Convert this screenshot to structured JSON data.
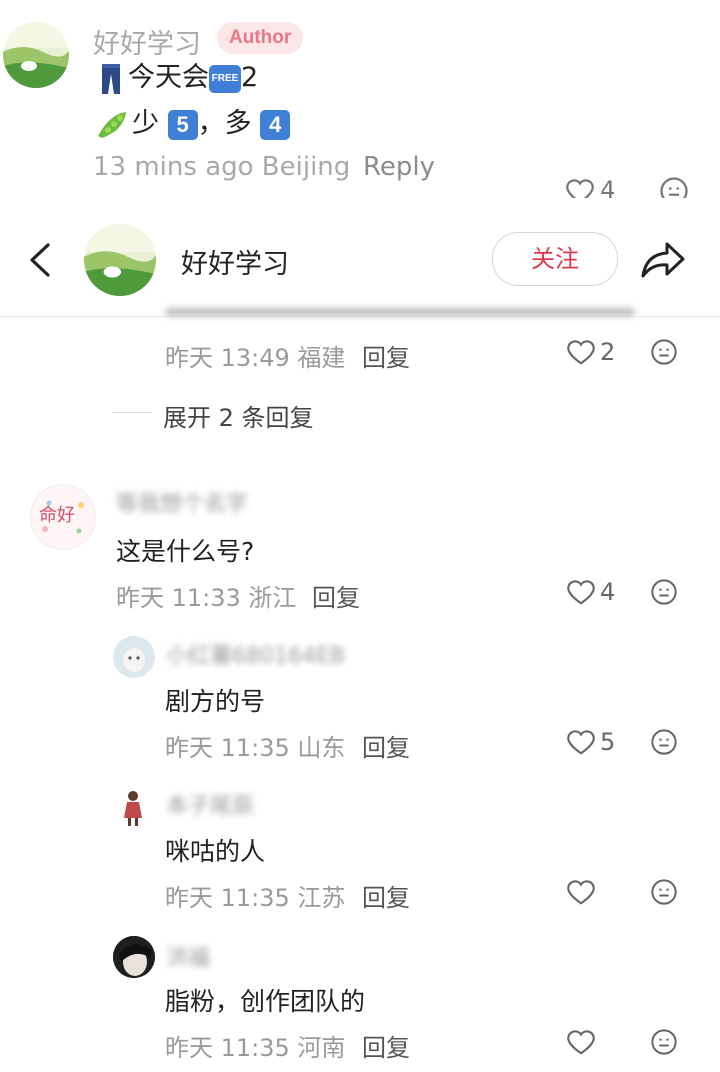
{
  "top_comment": {
    "author": "好好学习",
    "author_badge": "Author",
    "line1_text": "今天会",
    "free_badge": "FREE",
    "line1_suffix": "2",
    "line2_a": "少",
    "num5": "5",
    "line2_sep": "，多",
    "num4": "4",
    "meta": "13 mins ago Beijing",
    "reply_label": "Reply",
    "like_count": "4"
  },
  "header": {
    "back_icon": "chevron-left-icon",
    "name": "好好学习",
    "follow_label": "关注",
    "share_icon": "share-arrow-icon"
  },
  "comments": {
    "c0": {
      "meta": "昨天 13:49 福建",
      "reply_label": "回复",
      "like_count": "2"
    },
    "expand_label": "展开 2 条回复",
    "c1": {
      "name": "等我想个名字",
      "avatar_text": "命好",
      "text": "这是什么号?",
      "meta": "昨天 11:33 浙江",
      "reply_label": "回复",
      "like_count": "4"
    },
    "r1": {
      "name": "小红薯680164EB",
      "text": "剧方的号",
      "meta": "昨天 11:35 山东",
      "reply_label": "回复",
      "like_count": "5"
    },
    "r2": {
      "name": "本子尾辰",
      "text": "咪咕的人",
      "meta": "昨天 11:35 江苏",
      "reply_label": "回复",
      "like_count": ""
    },
    "r3": {
      "name": "洪福",
      "text": "脂粉，创作团队的",
      "meta": "昨天 11:35 河南",
      "reply_label": "回复"
    }
  },
  "colors": {
    "accent": "#e03a4f",
    "badge_blue": "#3f7fd6",
    "author_badge_bg": "#fbe6e8"
  }
}
